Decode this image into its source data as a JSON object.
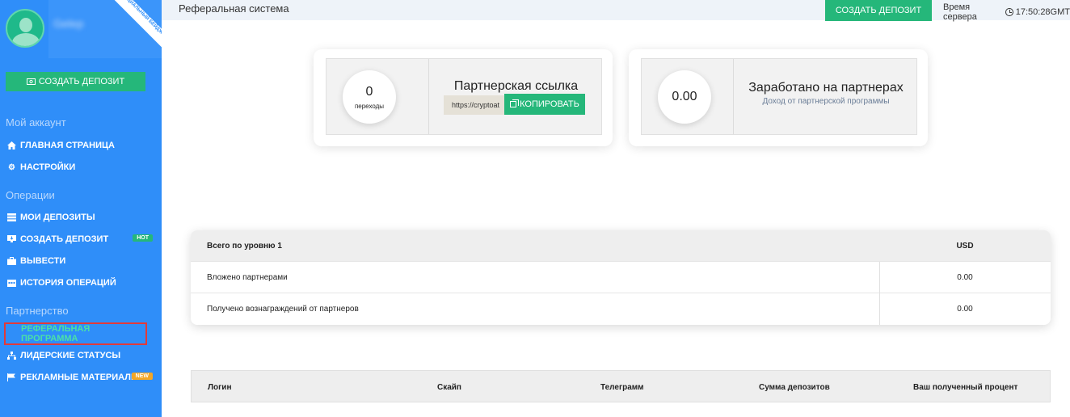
{
  "sidebar": {
    "username": "Gelep",
    "ribbon": "ОФИЦИАЛЬНЫЙ БЕЙДЖ",
    "deposit_button": "СОЗДАТЬ ДЕПОЗИТ",
    "sections": {
      "account": "Мой аккаунт",
      "operations": "Операции",
      "partnership": "Партнерство"
    },
    "items": [
      {
        "label": "ГЛАВНАЯ СТРАНИЦА",
        "icon": "home-icon"
      },
      {
        "label": "НАСТРОЙКИ",
        "icon": "gear-icon"
      },
      {
        "label": "МОИ ДЕПОЗИТЫ",
        "icon": "server-icon"
      },
      {
        "label": "СОЗДАТЬ ДЕПОЗИТ",
        "icon": "monitor-download-icon",
        "badge": "HOT"
      },
      {
        "label": "ВЫВЕСТИ",
        "icon": "briefcase-icon"
      },
      {
        "label": "ИСТОРИЯ ОПЕРАЦИЙ",
        "icon": "calendar-icon"
      },
      {
        "label": "РЕФЕРАЛЬНАЯ ПРОГРАММА",
        "icon": "",
        "active": true
      },
      {
        "label": "ЛИДЕРСКИЕ СТАТУСЫ",
        "icon": "sitemap-icon"
      },
      {
        "label": "РЕКЛАМНЫЕ МАТЕРИАЛЫ",
        "icon": "flag-icon",
        "badge": "NEW"
      }
    ]
  },
  "header": {
    "title": "Реферальная система",
    "create_button": "СОЗДАТЬ ДЕПОЗИТ",
    "server_time_label": "Время сервера",
    "server_time": "17:50:28GMT"
  },
  "cards": {
    "link": {
      "count": "0",
      "count_label": "переходы",
      "title": "Партнерская ссылка",
      "link_value": "https://cryptoat",
      "copy_button": "КОПИРОВАТЬ"
    },
    "earned": {
      "amount": "0.00",
      "title": "Заработано на партнерах",
      "subtitle": "Доход от партнерской программы"
    }
  },
  "level_table": {
    "header": {
      "label": "Всего по уровню 1",
      "currency": "USD"
    },
    "rows": [
      {
        "label": "Вложено партнерами",
        "value": "0.00"
      },
      {
        "label": "Получено вознаграждений от партнеров",
        "value": "0.00"
      }
    ]
  },
  "partners_table": {
    "columns": [
      "Логин",
      "Скайп",
      "Телеграмм",
      "Сумма депозитов",
      "Ваш полученный процент"
    ]
  },
  "colors": {
    "sidebar": "#2f8ef9",
    "accent_green": "#25b77a",
    "active_text": "#4be0a6",
    "active_border": "#e23a3a",
    "badge_new": "#f2a626"
  }
}
